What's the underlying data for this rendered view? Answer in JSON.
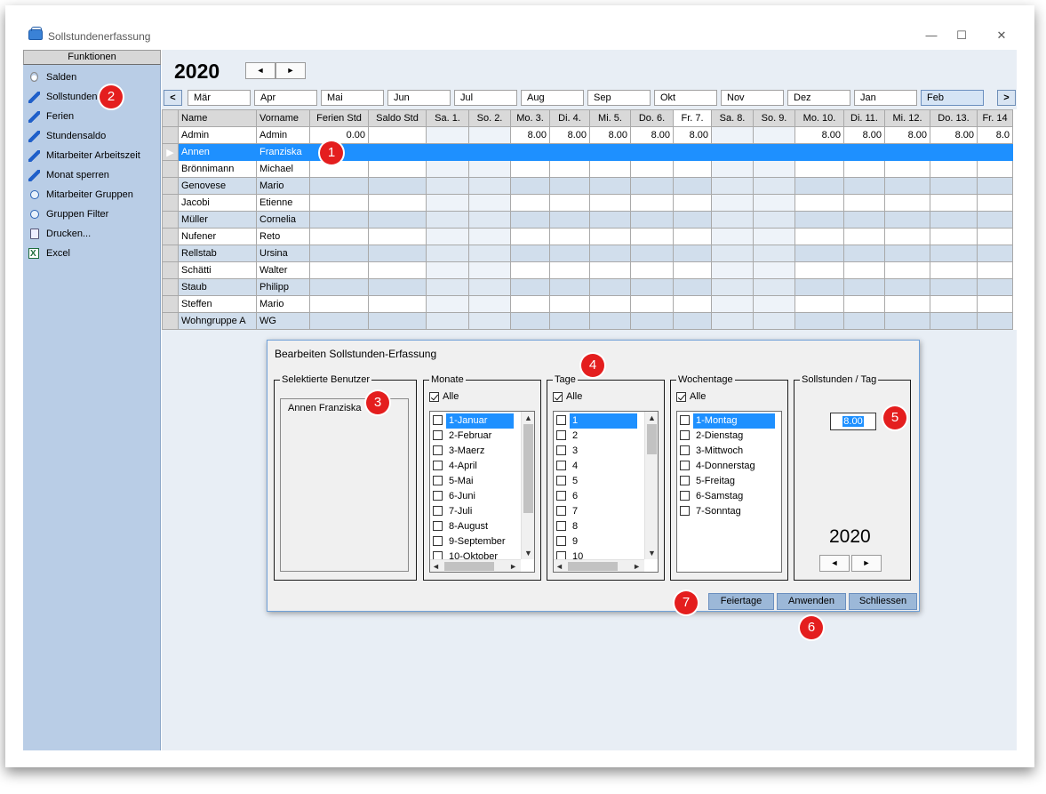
{
  "window": {
    "title": "Sollstundenerfassung",
    "minimize": "—",
    "maximize": "☐",
    "close": "✕"
  },
  "sidebar": {
    "header": "Funktionen",
    "items": [
      {
        "label": "Salden",
        "icon": "bulb-icon"
      },
      {
        "label": "Sollstunden",
        "icon": "pencil-icon"
      },
      {
        "label": "Ferien",
        "icon": "pencil-icon"
      },
      {
        "label": "Stundensaldo",
        "icon": "pencil-icon"
      },
      {
        "label": "Mitarbeiter Arbeitszeit",
        "icon": "pencil-icon"
      },
      {
        "label": "Monat sperren",
        "icon": "pencil-icon"
      },
      {
        "label": "Mitarbeiter Gruppen",
        "icon": "circle-icon"
      },
      {
        "label": "Gruppen Filter",
        "icon": "circle-icon"
      },
      {
        "label": "Drucken...",
        "icon": "print-icon"
      },
      {
        "label": "Excel",
        "icon": "excel-icon"
      }
    ]
  },
  "main": {
    "year": "2020",
    "prev": "◄",
    "next": "►",
    "month_prev": "<",
    "month_next": ">",
    "months": [
      "Mär",
      "Apr",
      "Mai",
      "Jun",
      "Jul",
      "Aug",
      "Sep",
      "Okt",
      "Nov",
      "Dez",
      "Jan",
      "Feb"
    ],
    "selected_month": "Feb"
  },
  "grid": {
    "columns": [
      "Name",
      "Vorname",
      "Ferien Std",
      "Saldo Std",
      "Sa. 1.",
      "So. 2.",
      "Mo. 3.",
      "Di. 4.",
      "Mi. 5.",
      "Do. 6.",
      "Fr. 7.",
      "Sa. 8.",
      "So. 9.",
      "Mo. 10.",
      "Di. 11.",
      "Mi. 12.",
      "Do. 13.",
      "Fr. 14"
    ],
    "today_column": "Fr. 7.",
    "rows": [
      {
        "name": "Admin",
        "vorname": "Admin",
        "ferien": "0.00",
        "saldo": "",
        "days": [
          "",
          "",
          "8.00",
          "8.00",
          "8.00",
          "8.00",
          "8.00",
          "",
          "",
          "8.00",
          "8.00",
          "8.00",
          "8.00",
          "8.0"
        ]
      },
      {
        "name": "Annen",
        "vorname": "Franziska",
        "ferien": "",
        "saldo": "",
        "days": [
          "",
          "",
          "",
          "",
          "",
          "",
          "",
          "",
          "",
          "",
          "",
          "",
          "",
          ""
        ],
        "selected": true
      },
      {
        "name": "Brönnimann",
        "vorname": "Michael",
        "ferien": "",
        "saldo": "",
        "days": [
          "",
          "",
          "",
          "",
          "",
          "",
          "",
          "",
          "",
          "",
          "",
          "",
          "",
          ""
        ]
      },
      {
        "name": "Genovese",
        "vorname": "Mario",
        "ferien": "",
        "saldo": "",
        "days": [
          "",
          "",
          "",
          "",
          "",
          "",
          "",
          "",
          "",
          "",
          "",
          "",
          "",
          ""
        ]
      },
      {
        "name": "Jacobi",
        "vorname": "Etienne",
        "ferien": "",
        "saldo": "",
        "days": [
          "",
          "",
          "",
          "",
          "",
          "",
          "",
          "",
          "",
          "",
          "",
          "",
          "",
          ""
        ]
      },
      {
        "name": "Müller",
        "vorname": "Cornelia",
        "ferien": "",
        "saldo": "",
        "days": [
          "",
          "",
          "",
          "",
          "",
          "",
          "",
          "",
          "",
          "",
          "",
          "",
          "",
          ""
        ]
      },
      {
        "name": "Nufener",
        "vorname": "Reto",
        "ferien": "",
        "saldo": "",
        "days": [
          "",
          "",
          "",
          "",
          "",
          "",
          "",
          "",
          "",
          "",
          "",
          "",
          "",
          ""
        ]
      },
      {
        "name": "Rellstab",
        "vorname": "Ursina",
        "ferien": "",
        "saldo": "",
        "days": [
          "",
          "",
          "",
          "",
          "",
          "",
          "",
          "",
          "",
          "",
          "",
          "",
          "",
          ""
        ]
      },
      {
        "name": "Schätti",
        "vorname": "Walter",
        "ferien": "",
        "saldo": "",
        "days": [
          "",
          "",
          "",
          "",
          "",
          "",
          "",
          "",
          "",
          "",
          "",
          "",
          "",
          ""
        ]
      },
      {
        "name": "Staub",
        "vorname": "Philipp",
        "ferien": "",
        "saldo": "",
        "days": [
          "",
          "",
          "",
          "",
          "",
          "",
          "",
          "",
          "",
          "",
          "",
          "",
          "",
          ""
        ]
      },
      {
        "name": "Steffen",
        "vorname": "Mario",
        "ferien": "",
        "saldo": "",
        "days": [
          "",
          "",
          "",
          "",
          "",
          "",
          "",
          "",
          "",
          "",
          "",
          "",
          "",
          ""
        ]
      },
      {
        "name": "Wohngruppe A",
        "vorname": "WG",
        "ferien": "",
        "saldo": "",
        "days": [
          "",
          "",
          "",
          "",
          "",
          "",
          "",
          "",
          "",
          "",
          "",
          "",
          "",
          ""
        ]
      }
    ]
  },
  "dialog": {
    "title": "Bearbeiten Sollstunden-Erfassung",
    "selected_users_label": "Selektierte Benutzer",
    "selected_user": "Annen  Franziska",
    "months_label": "Monate",
    "days_label": "Tage",
    "weekdays_label": "Wochentage",
    "hours_label": "Sollstunden / Tag",
    "all_label": "Alle",
    "months": [
      "1-Januar",
      "2-Februar",
      "3-Maerz",
      "4-April",
      "5-Mai",
      "6-Juni",
      "7-Juli",
      "8-August",
      "9-September",
      "10-Oktober"
    ],
    "days": [
      "1",
      "2",
      "3",
      "4",
      "5",
      "6",
      "7",
      "8",
      "9",
      "10"
    ],
    "weekdays": [
      "1-Montag",
      "2-Dienstag",
      "3-Mittwoch",
      "4-Donnerstag",
      "5-Freitag",
      "6-Samstag",
      "7-Sonntag"
    ],
    "hours_value": "8.00",
    "year": "2020",
    "prev": "◄",
    "next": "►",
    "btn_holidays": "Feiertage",
    "btn_apply": "Anwenden",
    "btn_close": "Schliessen"
  },
  "badges": [
    "1",
    "2",
    "3",
    "4",
    "5",
    "6",
    "7"
  ],
  "colors": {
    "accent": "#1e90ff",
    "sidebar": "#b9cde6",
    "badge": "#e41e1e",
    "alt_row": "#d1deec"
  }
}
